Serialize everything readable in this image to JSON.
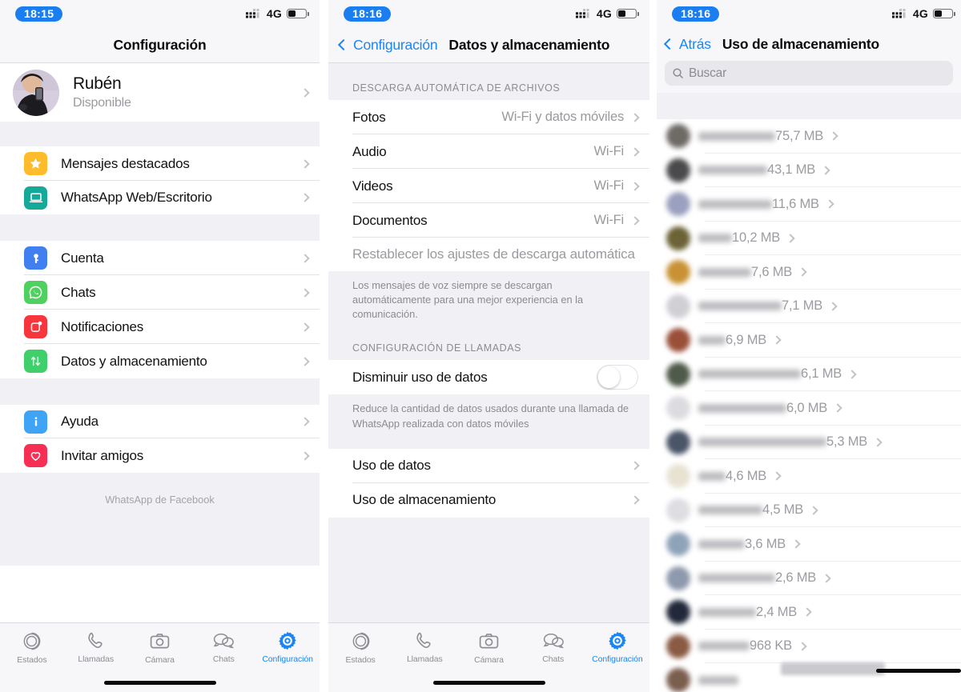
{
  "panels": [
    {
      "name": "settings",
      "status": {
        "time": "18:15",
        "network": "4G",
        "signal_icon": "signal-dots-icon",
        "battery_icon": "battery-icon"
      },
      "navbar": {
        "title": "Configuración"
      },
      "profile": {
        "name": "Rubén",
        "status": "Disponible",
        "avatar_icon": "avatar"
      },
      "groups": [
        {
          "items": [
            {
              "label": "Mensajes destacados",
              "icon": "star-icon",
              "color": "#febb2b"
            },
            {
              "label": "WhatsApp Web/Escritorio",
              "icon": "laptop-icon",
              "color": "#15a99a"
            }
          ]
        },
        {
          "items": [
            {
              "label": "Cuenta",
              "icon": "key-icon",
              "color": "#3f7ff0"
            },
            {
              "label": "Chats",
              "icon": "whatsapp-icon",
              "color": "#4fd15f"
            },
            {
              "label": "Notificaciones",
              "icon": "bell-badge-icon",
              "color": "#f6363c"
            },
            {
              "label": "Datos y almacenamiento",
              "icon": "arrows-updown-icon",
              "color": "#3fd06b"
            }
          ]
        },
        {
          "items": [
            {
              "label": "Ayuda",
              "icon": "info-icon",
              "color": "#3fa3f6"
            },
            {
              "label": "Invitar amigos",
              "icon": "heart-icon",
              "color": "#f72f55"
            }
          ]
        }
      ],
      "brandline": "WhatsApp de Facebook"
    },
    {
      "name": "data-and-storage",
      "status": {
        "time": "18:16",
        "network": "4G",
        "signal_icon": "signal-dots-icon",
        "battery_icon": "battery-icon"
      },
      "navbar": {
        "back_label": "Configuración",
        "title": "Datos y almacenamiento"
      },
      "section1_header": "DESCARGA AUTOMÁTICA DE ARCHIVOS",
      "autodownload": [
        {
          "label": "Fotos",
          "value": "Wi-Fi y datos móviles"
        },
        {
          "label": "Audio",
          "value": "Wi-Fi"
        },
        {
          "label": "Videos",
          "value": "Wi-Fi"
        },
        {
          "label": "Documentos",
          "value": "Wi-Fi"
        }
      ],
      "reset_label": "Restablecer los ajustes de descarga automática",
      "footnote1": "Los mensajes de voz siempre se descargan automáticamente para una mejor experiencia en la comunicación.",
      "section2_header": "CONFIGURACIÓN DE LLAMADAS",
      "low_data": {
        "label": "Disminuir uso de datos",
        "enabled": false
      },
      "footnote2": "Reduce la cantidad de datos usados durante una llamada de WhatsApp realizada con datos móviles",
      "links": [
        {
          "label": "Uso de datos"
        },
        {
          "label": "Uso de almacenamiento"
        }
      ]
    },
    {
      "name": "storage-usage",
      "status": {
        "time": "18:16",
        "network": "4G",
        "signal_icon": "signal-dots-icon",
        "battery_icon": "battery-icon"
      },
      "navbar": {
        "back_label": "Atrás",
        "title": "Uso de almacenamiento"
      },
      "search": {
        "placeholder": "Buscar",
        "value": "",
        "icon": "search-icon"
      },
      "rows": [
        {
          "name_masked": true,
          "size": "75,7 MB",
          "avatar_color": "#6e6a66"
        },
        {
          "name_masked": true,
          "size": "43,1 MB",
          "avatar_color": "#4a4a4c"
        },
        {
          "name_masked": true,
          "size": "11,6 MB",
          "avatar_color": "#9aa0bf"
        },
        {
          "name_masked": true,
          "size": "10,2 MB",
          "avatar_color": "#6b6236"
        },
        {
          "name_masked": true,
          "size": "7,6 MB",
          "avatar_color": "#c89234"
        },
        {
          "name_masked": true,
          "size": "7,1 MB",
          "avatar_color": "#cfcfd4"
        },
        {
          "name_masked": true,
          "size": "6,9 MB",
          "avatar_color": "#9a4f38"
        },
        {
          "name_masked": true,
          "size": "6,1 MB",
          "avatar_color": "#4f5a4a"
        },
        {
          "name_masked": true,
          "size": "6,0 MB",
          "avatar_color": "#dcdce0"
        },
        {
          "name_masked": true,
          "size": "5,3 MB",
          "avatar_color": "#4a5568"
        },
        {
          "name_masked": true,
          "size": "4,6 MB",
          "avatar_color": "#e8e2d2"
        },
        {
          "name_masked": true,
          "size": "4,5 MB",
          "avatar_color": "#dedee2"
        },
        {
          "name_masked": true,
          "size": "3,6 MB",
          "avatar_color": "#8fa3b8"
        },
        {
          "name_masked": true,
          "size": "2,6 MB",
          "avatar_color": "#8e99ad"
        },
        {
          "name_masked": true,
          "size": "2,4 MB",
          "avatar_color": "#22283a"
        },
        {
          "name_masked": true,
          "size": "968 KB",
          "avatar_color": "#8a5a43"
        }
      ]
    }
  ],
  "tabbar": {
    "items": [
      {
        "label": "Estados",
        "icon": "status-rings-icon",
        "active": false
      },
      {
        "label": "Llamadas",
        "icon": "phone-icon",
        "active": false
      },
      {
        "label": "Cámara",
        "icon": "camera-icon",
        "active": false
      },
      {
        "label": "Chats",
        "icon": "chat-bubbles-icon",
        "active": false
      },
      {
        "label": "Configuración",
        "icon": "gear-icon",
        "active": true
      }
    ],
    "active_color": "#1a86f5",
    "inactive_color": "#8d8d93"
  }
}
